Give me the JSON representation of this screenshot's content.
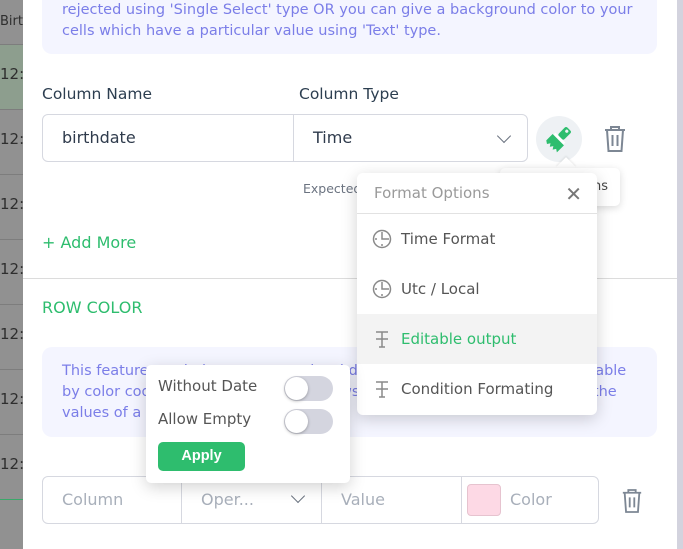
{
  "backdrop": {
    "header": "Birt",
    "cells": [
      "12:0",
      "12:0",
      "12:0",
      "12:0",
      "12:0",
      "12:0",
      "12:0"
    ]
  },
  "info_top": {
    "text": "rejected using 'Single Select' type OR you can give a background color to your cells which have a particular value using 'Text' type."
  },
  "column_form": {
    "name_label": "Column Name",
    "type_label": "Column Type",
    "name_value": "birthdate",
    "type_value": "Time",
    "hint": "Expected",
    "brush_tooltip": "Format Options",
    "add_more": "Add More"
  },
  "format_menu": {
    "title": "Format Options",
    "items": [
      {
        "label": "Time Format",
        "icon": "clock-icon",
        "active": false
      },
      {
        "label": "Utc / Local",
        "icon": "clock-icon",
        "active": false
      },
      {
        "label": "Editable output",
        "icon": "text-strike-icon",
        "active": true
      },
      {
        "label": "Condition Formating",
        "icon": "text-strike-icon",
        "active": false
      }
    ]
  },
  "row_color": {
    "title": "ROW COLOR",
    "info_text": "This feature can help you create visual distinction between rows in your table by color coding them. You can color rows using different colors based on the values of a particular column.",
    "column_placeholder": "Column",
    "operator_placeholder": "Oper...",
    "value_placeholder": "Value",
    "color_placeholder": "Color",
    "swatch_color": "#fdd9e5"
  },
  "toggle_popup": {
    "without_date_label": "Without Date",
    "without_date_on": false,
    "allow_empty_label": "Allow Empty",
    "allow_empty_on": false,
    "apply_label": "Apply"
  },
  "colors": {
    "accent": "#2ebd6e",
    "info_text": "#7b7ee8",
    "info_bg": "#f4f5ff"
  }
}
